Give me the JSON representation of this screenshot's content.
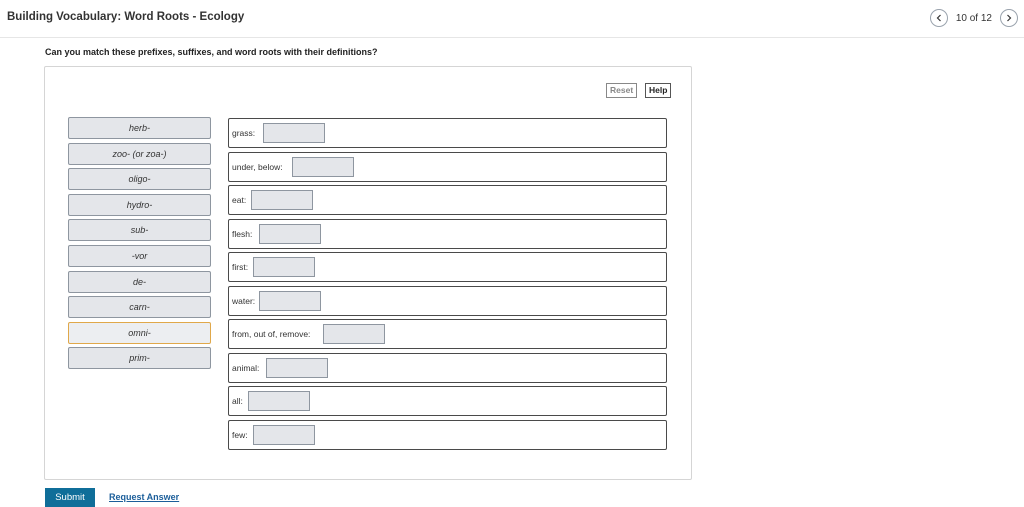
{
  "header": {
    "title": "Building Vocabulary: Word Roots - Ecology",
    "page_count": "10 of 12",
    "prev_icon": "chevron-left-icon",
    "next_icon": "chevron-right-icon"
  },
  "question": "Can you match these prefixes, suffixes, and word roots with their definitions?",
  "toolbar": {
    "reset_label": "Reset",
    "help_label": "Help"
  },
  "chips": [
    {
      "label": "herb-"
    },
    {
      "label": "zoo- (or zoa-)"
    },
    {
      "label": "oligo-"
    },
    {
      "label": "hydro-"
    },
    {
      "label": "sub-"
    },
    {
      "label": "-vor"
    },
    {
      "label": "de-"
    },
    {
      "label": "carn-"
    },
    {
      "label": "omni-",
      "active": true
    },
    {
      "label": "prim-"
    }
  ],
  "definitions": [
    {
      "label": "grass:"
    },
    {
      "label": "under, below:"
    },
    {
      "label": "eat:"
    },
    {
      "label": "flesh:"
    },
    {
      "label": "first:"
    },
    {
      "label": "water:"
    },
    {
      "label": "from, out of, remove:"
    },
    {
      "label": "animal:"
    },
    {
      "label": "all:"
    },
    {
      "label": "few:"
    }
  ],
  "footer": {
    "submit_label": "Submit",
    "request_label": "Request Answer"
  },
  "colors": {
    "submit": "#0f6e99",
    "link": "#1b5e9a",
    "active_chip_border": "#e0a84a"
  }
}
